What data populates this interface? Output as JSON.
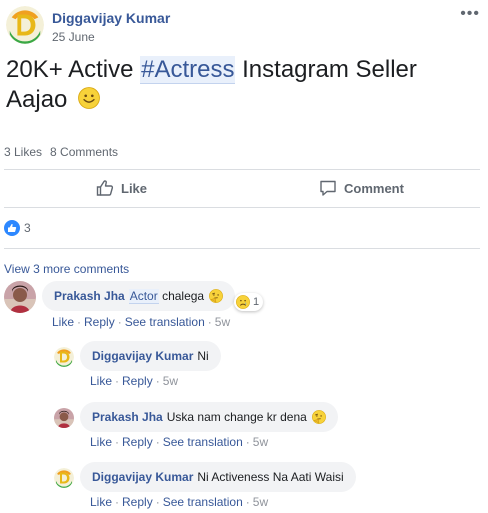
{
  "post": {
    "author": "Diggavijay Kumar",
    "date": "25 June",
    "more_label": "•••",
    "text_before": "20K+ Active ",
    "hashtag": "#Actress",
    "text_after": " Instagram Seller Aajao",
    "likes_text": "3 Likes",
    "comments_text": "8 Comments",
    "reaction_count": "3"
  },
  "actions": {
    "like_label": "Like",
    "comment_label": "Comment"
  },
  "view_more": "View 3 more comments",
  "comments": [
    {
      "author": "Prakash Jha",
      "mention": "Actor",
      "text": " chalega",
      "reaction_count": "1",
      "actions": [
        "Like",
        "Reply",
        "See translation"
      ],
      "time": "5w"
    },
    {
      "author": "Diggavijay Kumar",
      "text": "Ni",
      "actions": [
        "Like",
        "Reply"
      ],
      "time": "5w"
    },
    {
      "author": "Prakash Jha",
      "text": "Uska nam change kr dena",
      "actions": [
        "Like",
        "Reply",
        "See translation"
      ],
      "time": "5w"
    },
    {
      "author": "Diggavijay Kumar",
      "text": "Ni Activeness Na Aati Waisi",
      "actions": [
        "Like",
        "Reply",
        "See translation"
      ],
      "time": "5w"
    }
  ],
  "colors": {
    "link": "#385898",
    "like_blue": "#2d88ff",
    "bubble": "#f2f3f5"
  }
}
